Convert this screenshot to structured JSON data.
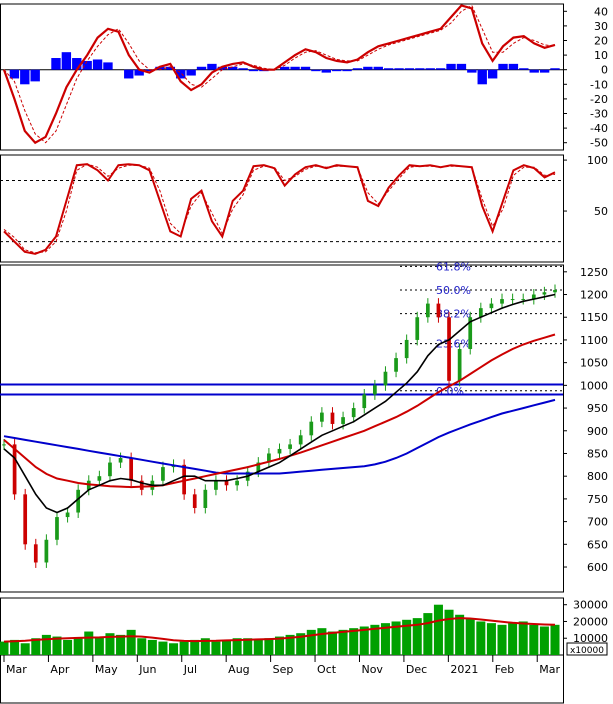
{
  "colors": {
    "background": "#ffffff",
    "panel_border": "#000000",
    "up_candle": "#1a9a1a",
    "down_candle": "#cc0000",
    "ma_short": "#000000",
    "ma_mid": "#cc0000",
    "ma_long": "#0000cc",
    "support_line": "#0000cc",
    "fib_text": "#2323c8",
    "macd_line": "#cc0000",
    "macd_hist": "#0000ff",
    "volume_bar": "#00a000",
    "volume_ma": "#cc0000"
  },
  "x_months": [
    "Mar",
    "Apr",
    "May",
    "Jun",
    "Jul",
    "Aug",
    "Sep",
    "Oct",
    "Nov",
    "Dec",
    "2021",
    "Feb",
    "Mar"
  ],
  "volume_unit_label": "x10000",
  "chart_data": [
    {
      "type": "line",
      "panel": "macd",
      "y_ticks": [
        40,
        30,
        20,
        10,
        0,
        -10,
        -20,
        -30,
        -40,
        -50
      ],
      "ylim": [
        -55,
        45
      ],
      "series": [
        {
          "values": [
            0,
            -20,
            -42,
            -50,
            -46,
            -30,
            -12,
            0,
            10,
            22,
            28,
            26,
            10,
            0,
            -2,
            2,
            4,
            -8,
            -14,
            -10,
            -2,
            2,
            4,
            5,
            2,
            0,
            0,
            5,
            10,
            14,
            12,
            8,
            6,
            5,
            7,
            12,
            16,
            18,
            20,
            22,
            24,
            26,
            28,
            36,
            44,
            42,
            18,
            6,
            16,
            22,
            23,
            18,
            15,
            17
          ]
        },
        {
          "values": [
            0,
            -8,
            -28,
            -44,
            -50,
            -42,
            -24,
            -6,
            6,
            16,
            24,
            28,
            18,
            6,
            0,
            0,
            2,
            -2,
            -10,
            -12,
            -6,
            0,
            2,
            4,
            3,
            1,
            0,
            3,
            8,
            12,
            13,
            10,
            7,
            6,
            6,
            10,
            14,
            17,
            19,
            21,
            23,
            25,
            27,
            32,
            40,
            44,
            28,
            12,
            12,
            18,
            22,
            20,
            17,
            16
          ]
        }
      ],
      "histogram": [
        0,
        -6,
        -10,
        -8,
        0,
        8,
        12,
        8,
        6,
        7,
        5,
        0,
        -6,
        -4,
        -1,
        2,
        2,
        -6,
        -4,
        2,
        4,
        2,
        2,
        1,
        -1,
        -1,
        0,
        2,
        2,
        2,
        -1,
        -2,
        -1,
        -1,
        1,
        2,
        2,
        1,
        1,
        1,
        1,
        1,
        1,
        4,
        4,
        -2,
        -10,
        -6,
        4,
        4,
        1,
        -2,
        -2,
        1
      ]
    },
    {
      "type": "line",
      "panel": "oscillator",
      "y_ticks": [
        100,
        50
      ],
      "ylim": [
        0,
        105
      ],
      "reference_lines": [
        80,
        20
      ],
      "series": [
        {
          "values": [
            30,
            20,
            10,
            8,
            12,
            25,
            60,
            95,
            96,
            90,
            80,
            95,
            96,
            95,
            90,
            60,
            30,
            25,
            62,
            70,
            40,
            25,
            60,
            70,
            94,
            95,
            92,
            75,
            86,
            93,
            95,
            92,
            95,
            94,
            93,
            60,
            55,
            73,
            85,
            95,
            94,
            95,
            93,
            95,
            94,
            93,
            55,
            30,
            60,
            90,
            95,
            92,
            83,
            88
          ]
        },
        {
          "values": [
            32,
            24,
            12,
            9,
            10,
            20,
            50,
            90,
            96,
            93,
            84,
            92,
            95,
            95,
            92,
            70,
            38,
            28,
            55,
            68,
            48,
            28,
            52,
            66,
            90,
            94,
            93,
            80,
            84,
            91,
            94,
            93,
            94,
            94,
            93,
            68,
            57,
            70,
            82,
            93,
            94,
            94,
            93,
            94,
            94,
            93,
            62,
            35,
            52,
            85,
            93,
            93,
            85,
            86
          ]
        }
      ]
    },
    {
      "type": "candlestick",
      "panel": "price",
      "y_ticks": [
        1250,
        1200,
        1150,
        1100,
        1050,
        1000,
        950,
        900,
        850,
        800,
        750,
        700,
        650,
        600
      ],
      "ylim": [
        545,
        1265
      ],
      "fibonacci": [
        {
          "label": "61.8%",
          "value": 1262
        },
        {
          "label": "50.0%",
          "value": 1210
        },
        {
          "label": "38.2%",
          "value": 1158
        },
        {
          "label": "23.6%",
          "value": 1092
        },
        {
          "label": "0.0%",
          "value": 988
        }
      ],
      "support_lines": [
        1002,
        980
      ],
      "close": [
        870,
        760,
        650,
        610,
        660,
        710,
        720,
        770,
        790,
        800,
        830,
        840,
        790,
        770,
        790,
        820,
        825,
        760,
        730,
        770,
        790,
        780,
        790,
        810,
        830,
        850,
        860,
        870,
        890,
        920,
        940,
        915,
        930,
        950,
        980,
        1000,
        1030,
        1060,
        1100,
        1150,
        1180,
        1150,
        1010,
        1080,
        1150,
        1170,
        1180,
        1190,
        1190,
        1190,
        1200,
        1205,
        1210
      ],
      "ma_short": [
        860,
        840,
        800,
        760,
        730,
        720,
        730,
        750,
        770,
        780,
        790,
        795,
        792,
        785,
        780,
        780,
        790,
        800,
        800,
        790,
        790,
        790,
        795,
        800,
        810,
        820,
        830,
        845,
        860,
        875,
        890,
        900,
        910,
        920,
        935,
        950,
        965,
        985,
        1005,
        1030,
        1065,
        1090,
        1100,
        1120,
        1140,
        1150,
        1160,
        1170,
        1178,
        1185,
        1190,
        1195,
        1200
      ],
      "ma_mid": [
        880,
        860,
        840,
        820,
        805,
        795,
        790,
        785,
        782,
        780,
        778,
        777,
        776,
        777,
        778,
        780,
        785,
        790,
        795,
        800,
        805,
        810,
        815,
        820,
        826,
        832,
        838,
        845,
        852,
        860,
        868,
        876,
        884,
        892,
        900,
        910,
        920,
        930,
        942,
        955,
        970,
        985,
        998,
        1010,
        1025,
        1040,
        1055,
        1068,
        1080,
        1090,
        1098,
        1105,
        1112
      ],
      "ma_long": [
        888,
        884,
        880,
        876,
        872,
        868,
        864,
        860,
        856,
        852,
        848,
        844,
        840,
        836,
        832,
        828,
        824,
        820,
        816,
        812,
        808,
        806,
        806,
        806,
        806,
        806,
        806,
        808,
        810,
        812,
        814,
        816,
        818,
        820,
        822,
        826,
        832,
        840,
        850,
        862,
        874,
        886,
        896,
        905,
        914,
        922,
        930,
        938,
        944,
        950,
        956,
        962,
        968
      ]
    },
    {
      "type": "bar",
      "panel": "volume",
      "y_ticks": [
        30000,
        20000,
        10000
      ],
      "ylim": [
        0,
        34000
      ],
      "values": [
        8000,
        9000,
        7000,
        10000,
        12000,
        11000,
        9000,
        10000,
        14000,
        11000,
        13000,
        12000,
        15000,
        10000,
        9000,
        8000,
        7000,
        8000,
        9000,
        10000,
        8000,
        9000,
        10000,
        10000,
        9000,
        10000,
        11000,
        12000,
        13000,
        15000,
        16000,
        14000,
        15000,
        16000,
        17000,
        18000,
        19000,
        20000,
        21000,
        22000,
        25000,
        30000,
        27000,
        24000,
        22000,
        20000,
        19000,
        18000,
        19000,
        20000,
        18000,
        17000,
        18000
      ],
      "ma": [
        8000,
        8200,
        8500,
        9000,
        9400,
        9800,
        10000,
        10200,
        10400,
        10500,
        10800,
        11000,
        11200,
        11000,
        10400,
        9600,
        8800,
        8400,
        8300,
        8400,
        8500,
        8700,
        8900,
        9100,
        9300,
        9500,
        9800,
        10300,
        10900,
        11700,
        12500,
        13200,
        13800,
        14400,
        15000,
        15600,
        16200,
        16800,
        17400,
        18000,
        19000,
        20500,
        21500,
        22000,
        21800,
        21200,
        20500,
        19800,
        19200,
        18800,
        18500,
        18200,
        18000
      ]
    }
  ]
}
